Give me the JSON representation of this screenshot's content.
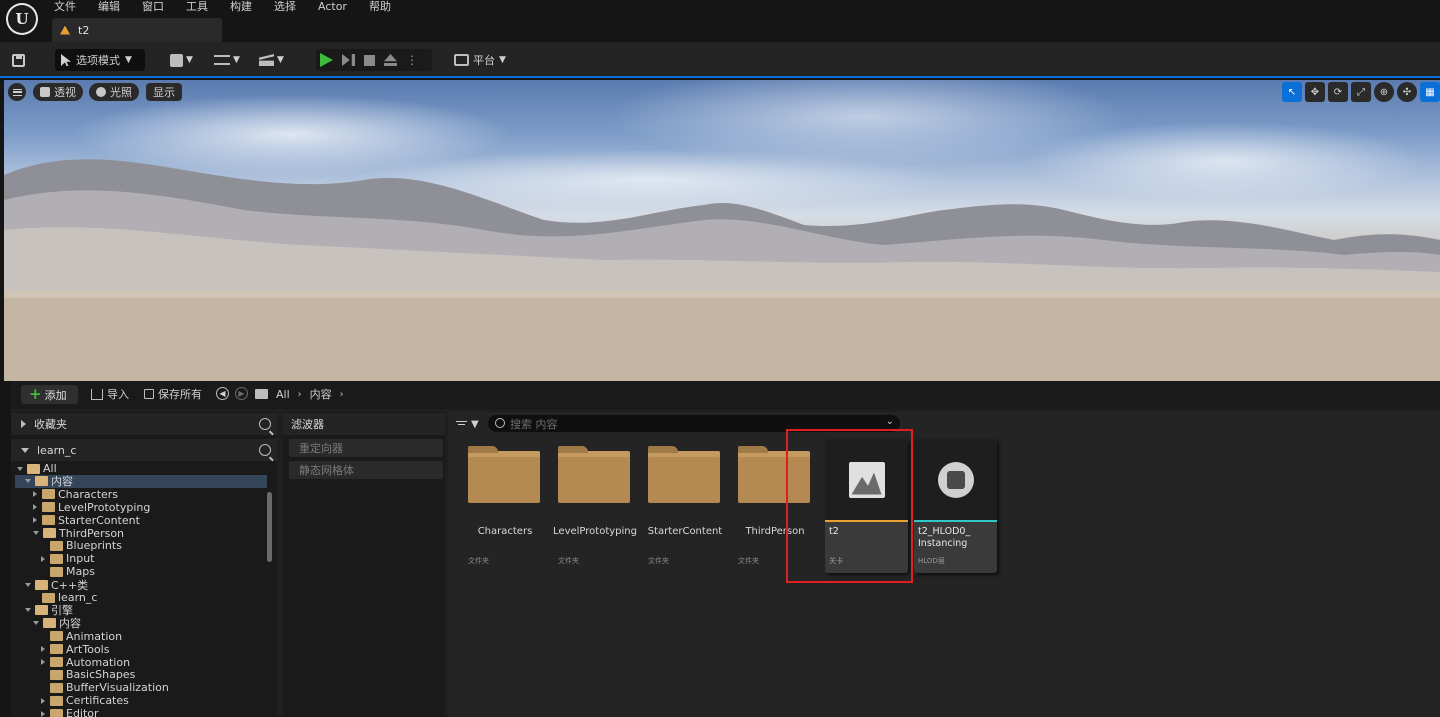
{
  "menubar": {
    "logo": "U",
    "items": [
      "文件",
      "编辑",
      "窗口",
      "工具",
      "构建",
      "选择",
      "Actor",
      "帮助"
    ],
    "level_tab": "t2"
  },
  "toolbar": {
    "mode_label": "选项模式",
    "platform_label": "平台"
  },
  "viewport": {
    "perspective_label": "透视",
    "lit_label": "光照",
    "show_label": "显示",
    "right_tools": [
      "select-icon",
      "move-icon",
      "rotate-icon",
      "scale-icon",
      "world-icon",
      "snap-icon",
      "grid-icon"
    ]
  },
  "content_browser": {
    "add_label": "添加",
    "import_label": "导入",
    "save_all_label": "保存所有",
    "breadcrumb": [
      "All",
      "内容"
    ],
    "favorites_label": "收藏夹",
    "project_label": "learn_c",
    "tree": [
      {
        "label": "All",
        "indent": 0,
        "state": "open",
        "selected": false
      },
      {
        "label": "内容",
        "indent": 1,
        "state": "open",
        "selected": true
      },
      {
        "label": "Characters",
        "indent": 2,
        "state": "closed",
        "selected": false
      },
      {
        "label": "LevelPrototyping",
        "indent": 2,
        "state": "closed",
        "selected": false
      },
      {
        "label": "StarterContent",
        "indent": 2,
        "state": "closed",
        "selected": false
      },
      {
        "label": "ThirdPerson",
        "indent": 2,
        "state": "open",
        "selected": false
      },
      {
        "label": "Blueprints",
        "indent": 3,
        "state": "none",
        "selected": false
      },
      {
        "label": "Input",
        "indent": 3,
        "state": "closed",
        "selected": false
      },
      {
        "label": "Maps",
        "indent": 3,
        "state": "none",
        "selected": false
      },
      {
        "label": "C++类",
        "indent": 1,
        "state": "open",
        "selected": false
      },
      {
        "label": "learn_c",
        "indent": 2,
        "state": "none",
        "selected": false
      },
      {
        "label": "引擎",
        "indent": 1,
        "state": "open",
        "selected": false
      },
      {
        "label": "内容",
        "indent": 2,
        "state": "open",
        "selected": false
      },
      {
        "label": "Animation",
        "indent": 3,
        "state": "none",
        "selected": false
      },
      {
        "label": "ArtTools",
        "indent": 3,
        "state": "closed",
        "selected": false
      },
      {
        "label": "Automation",
        "indent": 3,
        "state": "closed",
        "selected": false
      },
      {
        "label": "BasicShapes",
        "indent": 3,
        "state": "none",
        "selected": false
      },
      {
        "label": "BufferVisualization",
        "indent": 3,
        "state": "none",
        "selected": false
      },
      {
        "label": "Certificates",
        "indent": 3,
        "state": "closed",
        "selected": false
      },
      {
        "label": "Editor",
        "indent": 3,
        "state": "closed",
        "selected": false
      }
    ],
    "filters_title": "滤波器",
    "filter_chips": [
      "重定向器",
      "静态网格体"
    ],
    "search_placeholder": "搜索 内容",
    "folders": [
      {
        "name": "Characters",
        "type": "文件夹"
      },
      {
        "name": "LevelPrototyping",
        "type": "文件夹"
      },
      {
        "name": "StarterContent",
        "type": "文件夹"
      },
      {
        "name": "ThirdPerson",
        "type": "文件夹"
      }
    ],
    "assets": [
      {
        "name": "t2",
        "type": "关卡",
        "bar_color": "#e8a030",
        "icon": "map-icon"
      },
      {
        "name": "t2_HLOD0_ Instancing",
        "type": "HLOD层",
        "bar_color": "#2ec8c8",
        "icon": "hlod-icon"
      }
    ],
    "highlight_color": "#e02020"
  }
}
